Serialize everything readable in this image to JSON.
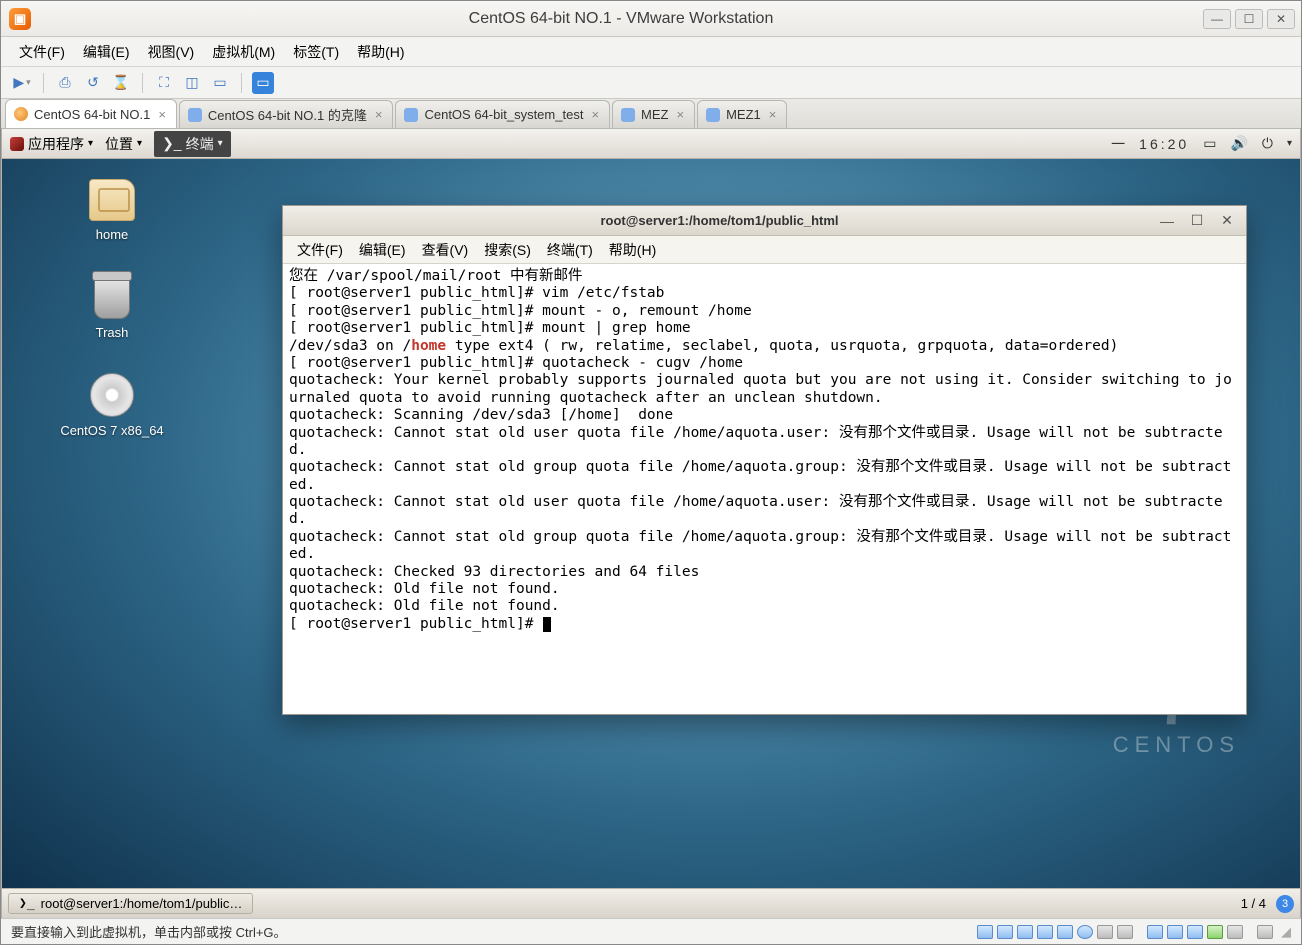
{
  "vmware": {
    "title": "CentOS 64-bit NO.1 - VMware Workstation",
    "menu": [
      "文件(F)",
      "编辑(E)",
      "视图(V)",
      "虚拟机(M)",
      "标签(T)",
      "帮助(H)"
    ],
    "tabs": [
      {
        "label": "CentOS 64-bit NO.1",
        "active": true
      },
      {
        "label": "CentOS 64-bit NO.1 的克隆"
      },
      {
        "label": "CentOS 64-bit_system_test"
      },
      {
        "label": "MEZ"
      },
      {
        "label": "MEZ1"
      }
    ],
    "footer_hint": "要直接输入到此虚拟机，单击内部或按 Ctrl+G。"
  },
  "gnome": {
    "apps_label": "应用程序",
    "places_label": "位置",
    "running_title": "终端",
    "clock": "16:20",
    "weekday": "一",
    "desktop": [
      {
        "name": "home"
      },
      {
        "name": "Trash"
      },
      {
        "name": "CentOS 7 x86_64"
      }
    ],
    "centos_word": "CENTOS",
    "task_label": "root@server1:/home/tom1/public…",
    "pager": "1 / 4",
    "pager_badge": "3"
  },
  "terminal": {
    "title": "root@server1:/home/tom1/public_html",
    "menu": [
      "文件(F)",
      "编辑(E)",
      "查看(V)",
      "搜索(S)",
      "终端(T)",
      "帮助(H)"
    ],
    "lines": [
      {
        "t": "您在 /var/spool/mail/root 中有新邮件"
      },
      {
        "t": "[ root@server1 public_html]# vim /etc/fstab"
      },
      {
        "t": "[ root@server1 public_html]# mount - o, remount /home"
      },
      {
        "t": "[ root@server1 public_html]# mount | grep home"
      },
      {
        "pre": "/dev/sda3 on /",
        "hl": "home",
        "post": " type ext4 ( rw, relatime, seclabel, quota, usrquota, grpquota, data=ordered)"
      },
      {
        "t": "[ root@server1 public_html]# quotacheck - cugv /home"
      },
      {
        "t": "quotacheck: Your kernel probably supports journaled quota but you are not using it. Consider switching to journaled quota to avoid running quotacheck after an unclean shutdown."
      },
      {
        "t": "quotacheck: Scanning /dev/sda3 [/home]  done"
      },
      {
        "t": "quotacheck: Cannot stat old user quota file /home/aquota.user: 没有那个文件或目录. Usage will not be subtracted."
      },
      {
        "t": "quotacheck: Cannot stat old group quota file /home/aquota.group: 没有那个文件或目录. Usage will not be subtracted."
      },
      {
        "t": "quotacheck: Cannot stat old user quota file /home/aquota.user: 没有那个文件或目录. Usage will not be subtracted."
      },
      {
        "t": "quotacheck: Cannot stat old group quota file /home/aquota.group: 没有那个文件或目录. Usage will not be subtracted."
      },
      {
        "t": "quotacheck: Checked 93 directories and 64 files"
      },
      {
        "t": "quotacheck: Old file not found."
      },
      {
        "t": "quotacheck: Old file not found."
      },
      {
        "t": "[ root@server1 public_html]# ",
        "cursor": true
      }
    ]
  }
}
